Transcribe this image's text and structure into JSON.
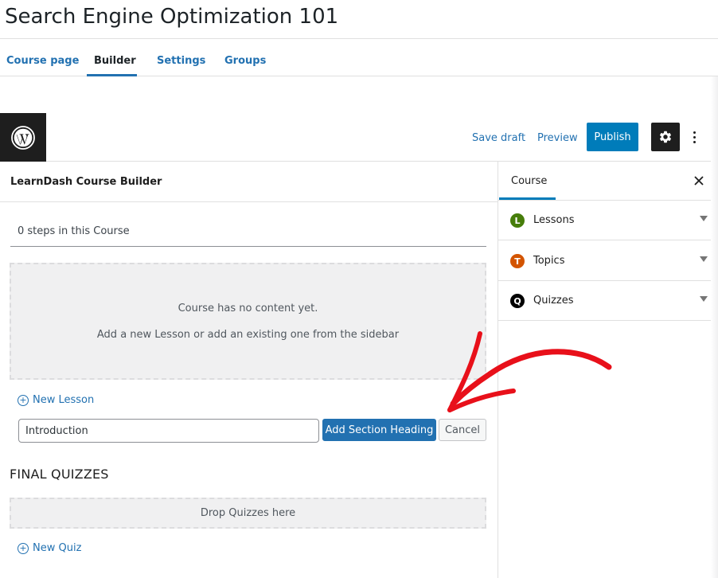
{
  "page": {
    "title": "Search Engine Optimization 101"
  },
  "tabs": [
    {
      "label": "Course page"
    },
    {
      "label": "Builder"
    },
    {
      "label": "Settings"
    },
    {
      "label": "Groups"
    }
  ],
  "editor_bar": {
    "save_draft": "Save draft",
    "preview": "Preview",
    "publish": "Publish"
  },
  "builder": {
    "title": "LearnDash Course Builder",
    "steps_count": "0 steps in this Course",
    "empty_line1": "Course has no content yet.",
    "empty_line2": "Add a new Lesson or add an existing one from the sidebar",
    "new_lesson": "New Lesson",
    "section_input_value": "Introduction",
    "add_section_heading": "Add Section Heading",
    "cancel": "Cancel",
    "final_quizzes_heading": "FINAL QUIZZES",
    "drop_quizzes": "Drop Quizzes here",
    "new_quiz": "New Quiz"
  },
  "sidebar": {
    "tab": "Course",
    "items": [
      {
        "badge": "L",
        "label": "Lessons",
        "color": "#467d0a"
      },
      {
        "badge": "T",
        "label": "Topics",
        "color": "#d35400"
      },
      {
        "badge": "Q",
        "label": "Quizzes",
        "color": "#000000"
      }
    ]
  },
  "colors": {
    "accent": "#2271b1",
    "publish": "#007cba",
    "annotation_arrow": "#e8101a"
  }
}
